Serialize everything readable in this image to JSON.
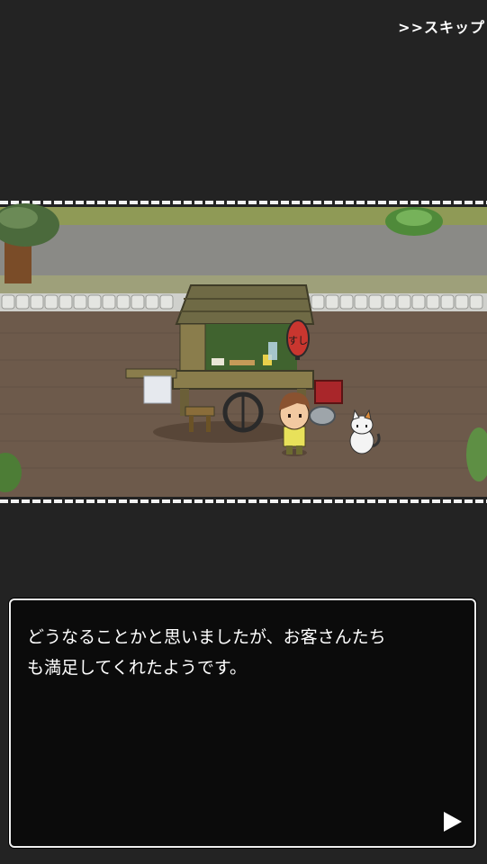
{
  "skip_label": ">>スキップ",
  "dialog": {
    "text": "どうなることかと思いましたが、お客さんたち\nも満足してくれたようです。"
  },
  "scene": {
    "lantern_text": "すし",
    "colors": {
      "grass": "#8f9a56",
      "gravel": "#8a8a86",
      "ground": "#6d5a4b",
      "stall_wood": "#6f6a45",
      "lantern": "#c9362f",
      "shirt": "#e8e15a"
    }
  },
  "icons": {
    "next": "play-triangle-icon"
  }
}
